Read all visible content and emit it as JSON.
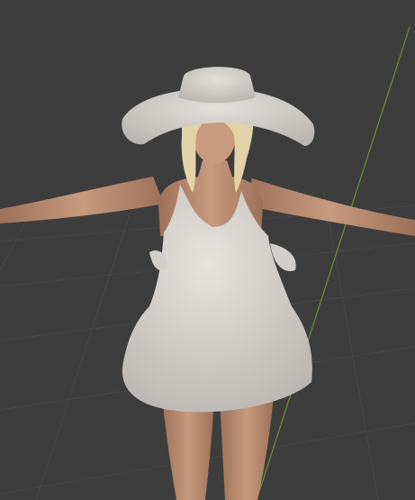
{
  "viewport": {
    "background_color": "#3d3d3d",
    "grid_color": "#474747",
    "y_axis_color": "#6f8f3a",
    "model": {
      "skin_color": "#c89a7e",
      "skin_shadow_color": "#9c7158",
      "dress_color": "#e6e3df",
      "dress_shadow_color": "#b9b6b2",
      "hat_color": "#e3e0dc",
      "hair_color": "#e3d1a8",
      "hair_shadow_color": "#c4ac7e"
    }
  }
}
